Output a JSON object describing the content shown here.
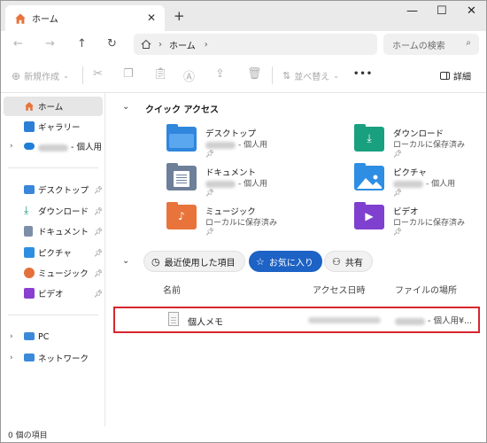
{
  "tab": {
    "title": "ホーム",
    "close": "✕",
    "new": "+"
  },
  "window_controls": {
    "minimize": "—",
    "maximize": "☐",
    "close": "✕"
  },
  "address": {
    "crumb": "ホーム",
    "sep1": "›",
    "sep2": "›"
  },
  "search": {
    "placeholder": "ホームの検索"
  },
  "toolbar": {
    "new_label": "新規作成",
    "sort_label": "並べ替え",
    "more_label": "•••",
    "details_label": "詳細"
  },
  "sidebar": {
    "items": [
      {
        "label": "ホーム",
        "icon": "home-icon",
        "color": "#e8743b"
      },
      {
        "label": "ギャラリー",
        "icon": "gallery-icon",
        "color": "#2d7fd5"
      },
      {
        "label": "- 個人用",
        "icon": "onedrive-icon",
        "color": "#1f7fd8"
      },
      {
        "label": "デスクトップ",
        "icon": "desktop-icon",
        "color": "#3a86d9"
      },
      {
        "label": "ダウンロード",
        "icon": "download-icon",
        "color": "#1a9d7e"
      },
      {
        "label": "ドキュメント",
        "icon": "documents-icon",
        "color": "#7d8fa8"
      },
      {
        "label": "ピクチャ",
        "icon": "pictures-icon",
        "color": "#2e8fe0"
      },
      {
        "label": "ミュージック",
        "icon": "music-icon",
        "color": "#e5703a"
      },
      {
        "label": "ビデオ",
        "icon": "videos-icon",
        "color": "#8a3fd1"
      },
      {
        "label": "PC",
        "icon": "pc-icon",
        "color": "#3b8ad9"
      },
      {
        "label": "ネットワーク",
        "icon": "network-icon",
        "color": "#3b8ad9"
      }
    ]
  },
  "quick_access": {
    "title": "クイック アクセス",
    "items": [
      {
        "name": "デスクトップ",
        "sub": "- 個人用",
        "color": "#2f86dd",
        "icon": "desktop-folder-icon"
      },
      {
        "name": "ダウンロード",
        "sub": "ローカルに保存済み",
        "color": "#19a07f",
        "icon": "download-folder-icon"
      },
      {
        "name": "ドキュメント",
        "sub": "- 個人用",
        "color": "#6d7f99",
        "icon": "documents-folder-icon"
      },
      {
        "name": "ピクチャ",
        "sub": "- 個人用",
        "color": "#2d8ee3",
        "icon": "pictures-folder-icon"
      },
      {
        "name": "ミュージック",
        "sub": "ローカルに保存済み",
        "color": "#e8743b",
        "icon": "music-folder-icon"
      },
      {
        "name": "ビデオ",
        "sub": "ローカルに保存済み",
        "color": "#7f3fcf",
        "icon": "videos-folder-icon"
      }
    ]
  },
  "filters": {
    "recent": "最近使用した項目",
    "favorites": "お気に入り",
    "shared": "共有"
  },
  "table": {
    "col_name": "名前",
    "col_access": "アクセス日時",
    "col_location": "ファイルの場所",
    "row": {
      "name": "個人メモ",
      "location": "- 個人用¥..."
    }
  },
  "status": {
    "text": "0 個の項目"
  },
  "colors": {
    "accent": "#1d62c5",
    "highlight_border": "#d6262f"
  }
}
